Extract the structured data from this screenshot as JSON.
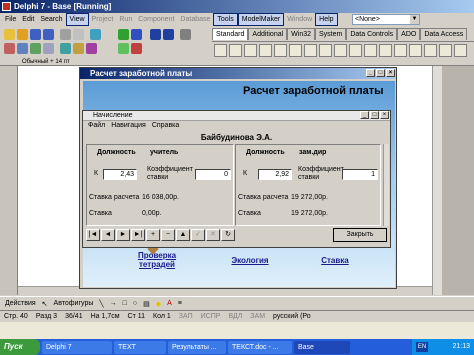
{
  "ide": {
    "title": "Delphi 7 - Base [Running]",
    "menu": [
      {
        "label": "File",
        "state": "normal"
      },
      {
        "label": "Edit",
        "state": "normal"
      },
      {
        "label": "Search",
        "state": "normal"
      },
      {
        "label": "View",
        "state": "boxed"
      },
      {
        "label": "Project",
        "state": "dim"
      },
      {
        "label": "Run",
        "state": "dim"
      },
      {
        "label": "Component",
        "state": "dim"
      },
      {
        "label": "Database",
        "state": "dim"
      },
      {
        "label": "Tools",
        "state": "boxed"
      },
      {
        "label": "ModelMaker",
        "state": "boxed"
      },
      {
        "label": "Window",
        "state": "dim"
      },
      {
        "label": "Help",
        "state": "boxed"
      }
    ],
    "combo_value": "<None>",
    "palette_tabs": [
      "Standard",
      "Additional",
      "Win32",
      "System",
      "Data Controls",
      "ADO",
      "Data Access"
    ]
  },
  "word": {
    "strip_text": "Обычный + 14 пт",
    "draw_bar": [
      "Действия",
      "Автофигуры"
    ],
    "status": {
      "page": "Стр. 40",
      "section": "Разд 3",
      "pages": "36/41",
      "at": "На 1,7см",
      "line": "Ст 11",
      "col": "Кол 1",
      "flags": [
        "ЗАП",
        "ИСПР",
        "ВДЛ",
        "ЗАМ"
      ],
      "lang": "русский (Ро"
    }
  },
  "taskbar": {
    "start": "Пуск",
    "tasks": [
      "Delphi 7",
      "TEXT",
      "Результаты ...",
      "ТЕКСТ.doc - ...",
      "Base"
    ],
    "active_task": "Base",
    "lang": "EN",
    "clock": "21:13"
  },
  "app": {
    "title": "Расчет заработной платы",
    "banner": "Расчет заработной платы",
    "links": [
      "Проверка тетрадей",
      "Экология",
      "Ставка"
    ]
  },
  "dialog": {
    "title": "Начисление",
    "menu": [
      "Файл",
      "Навигация",
      "Справка"
    ],
    "employee": "Байбудинова Э.А.",
    "left": {
      "position_label": "Должность",
      "position_value": "учитель",
      "k_label": "К",
      "k_value": "2,43",
      "coef_label": "Коэффициент ставки",
      "coef_value": "0",
      "rate_calc_label": "Ставка расчета",
      "rate_calc_value": "16 038,00р.",
      "rate_label": "Ставка",
      "rate_value": "0,00р."
    },
    "right": {
      "position_label": "Должность",
      "position_value": "зам.дир",
      "k_label": "К",
      "k_value": "2,92",
      "coef_label": "Коэффициент ставки",
      "coef_value": "1",
      "rate_calc_label": "Ставка расчета",
      "rate_calc_value": "19 272,00р.",
      "rate_label": "Ставка",
      "rate_value": "19 272,00р."
    },
    "nav_buttons": [
      "|◄",
      "◄",
      "►",
      "►|",
      "+",
      "−",
      "▲",
      "✓",
      "✕",
      "↻"
    ],
    "close_label": "Закрыть"
  },
  "colors": {
    "title_active": "#0a246a",
    "banner_sky": "#5b9bd5",
    "link": "#1a1a8c"
  }
}
